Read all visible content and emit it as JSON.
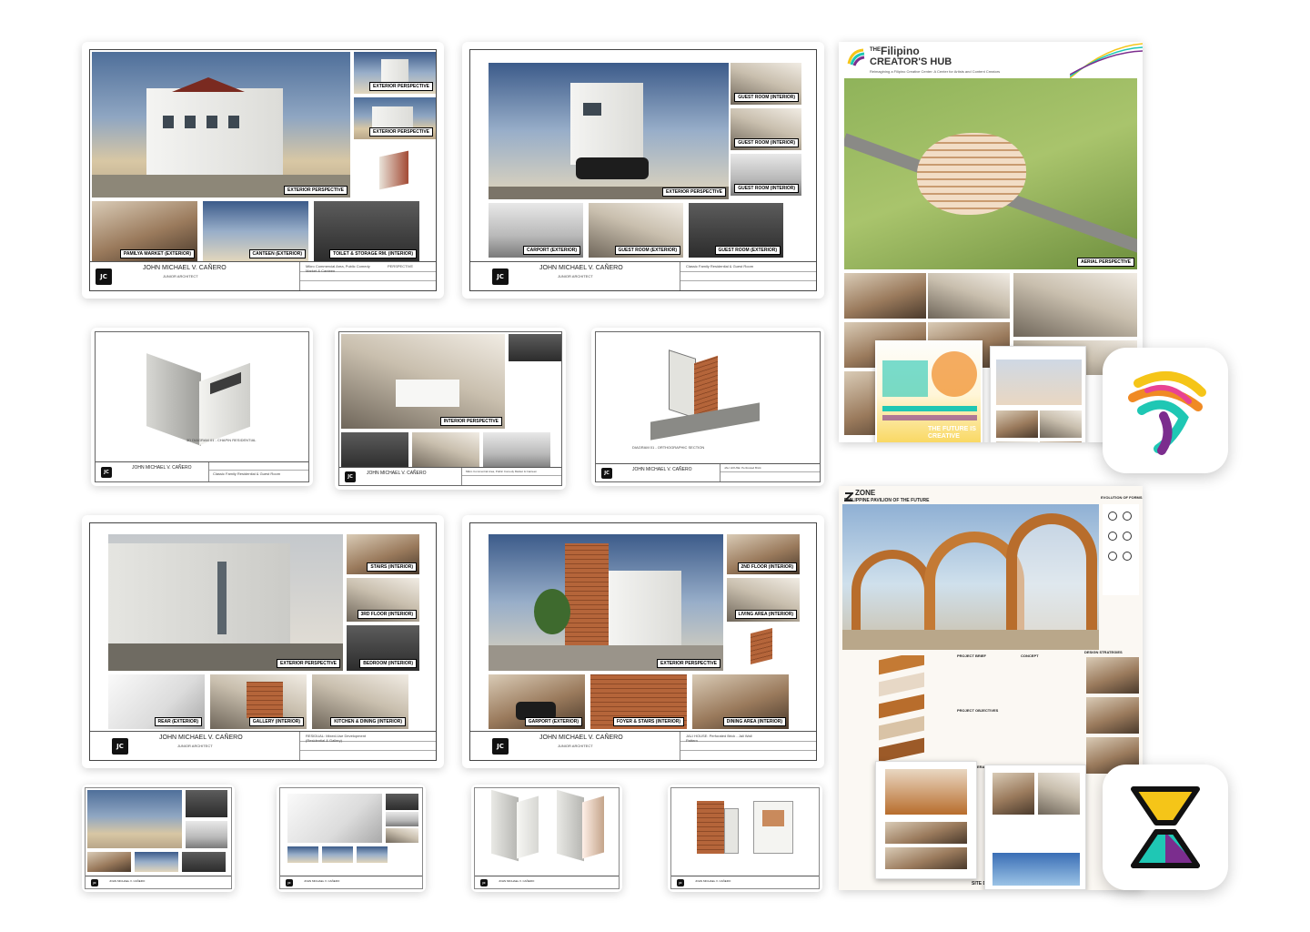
{
  "designer": {
    "name": "JOHN MICHAEL V. CAÑERO",
    "role": "JUNIOR ARCHITECT",
    "logo_text": "JC"
  },
  "sheets": {
    "s1": {
      "project": "Mikro Commercial Area, Public Comedy Market & Canteen",
      "perspective": "PERSPECTIVE",
      "labels": [
        "EXTERIOR PERSPECTIVE",
        "EXTERIOR PERSPECTIVE",
        "EXTERIOR PERSPECTIVE",
        "PAMILYA MARKET (EXTERIOR)",
        "CANTEEN (EXTERIOR)",
        "TOILET & STORAGE RM. (INTERIOR)"
      ]
    },
    "s2": {
      "project": "Classic Family Residential & Guest Room",
      "labels": [
        "GUEST ROOM (INTERIOR)",
        "GUEST ROOM (INTERIOR)",
        "GUEST ROOM (INTERIOR)",
        "EXTERIOR PERSPECTIVE",
        "CARPORT (EXTERIOR)",
        "GUEST ROOM (EXTERIOR)",
        "GUEST ROOM (EXTERIOR)"
      ]
    },
    "s3": {
      "project": "Classic Family Residential & Guest Room",
      "caption": "3D DIAGRAM 01 - CHAPIN RESIDENTIAL"
    },
    "s4": {
      "project": "Mikro Commercial Area, Public Comedy Market & Canteen",
      "labels": [
        "INTERIOR PERSPECTIVE"
      ]
    },
    "s5": {
      "project": "JALI HOUSE: Perforated Brick",
      "caption": "DIAGRAM 01 - ORTHOGRAPHIC SECTION"
    },
    "s6": {
      "project": "RESIDUAL: Mixed-Use Development (Residential & Gallery)",
      "labels": [
        "STAIRS (INTERIOR)",
        "3RD FLOOR (INTERIOR)",
        "BEDROOM (INTERIOR)",
        "EXTERIOR PERSPECTIVE",
        "REAR (EXTERIOR)",
        "GALLERY (INTERIOR)",
        "KITCHEN & DINING (INTERIOR)"
      ]
    },
    "s7": {
      "project": "JALI HOUSE: Perforated Brick - Jali Wall Pattern",
      "labels": [
        "2ND FLOOR (INTERIOR)",
        "LIVING AREA (INTERIOR)",
        "DINING AREA (INTERIOR)",
        "EXTERIOR PERSPECTIVE",
        "GARPORT (EXTERIOR)",
        "FOYER & STAIRS (INTERIOR)",
        "DINING AREA (INTERIOR)"
      ]
    }
  },
  "posters": {
    "creators_hub": {
      "title_prefix": "THE",
      "title_main": "Filipino",
      "title_sub": "CREATOR'S HUB",
      "tagline": "Reimagining a Filipino Creative Center: A Center for Artists and Content Creators",
      "aerial_label": "AERIAL PERSPECTIVE",
      "slogan": "THE FUTURE IS CREATIVE"
    },
    "zone": {
      "title": "ZONE",
      "subtitle": "PHILIPPINE PAVILION OF THE FUTURE",
      "sections": [
        "EVOLUTION OF FORMS",
        "PROJECT BRIEF",
        "CONCEPT",
        "PROJECT OBJECTIVES",
        "DESIGN STRATEGIES",
        "DESIGN CONSIDERATIONS",
        "SITE DE"
      ]
    }
  },
  "colors": {
    "accent_yellow": "#f5c518",
    "accent_teal": "#1fc7b4",
    "accent_purple": "#7b2d8e",
    "accent_orange": "#f08a24"
  }
}
